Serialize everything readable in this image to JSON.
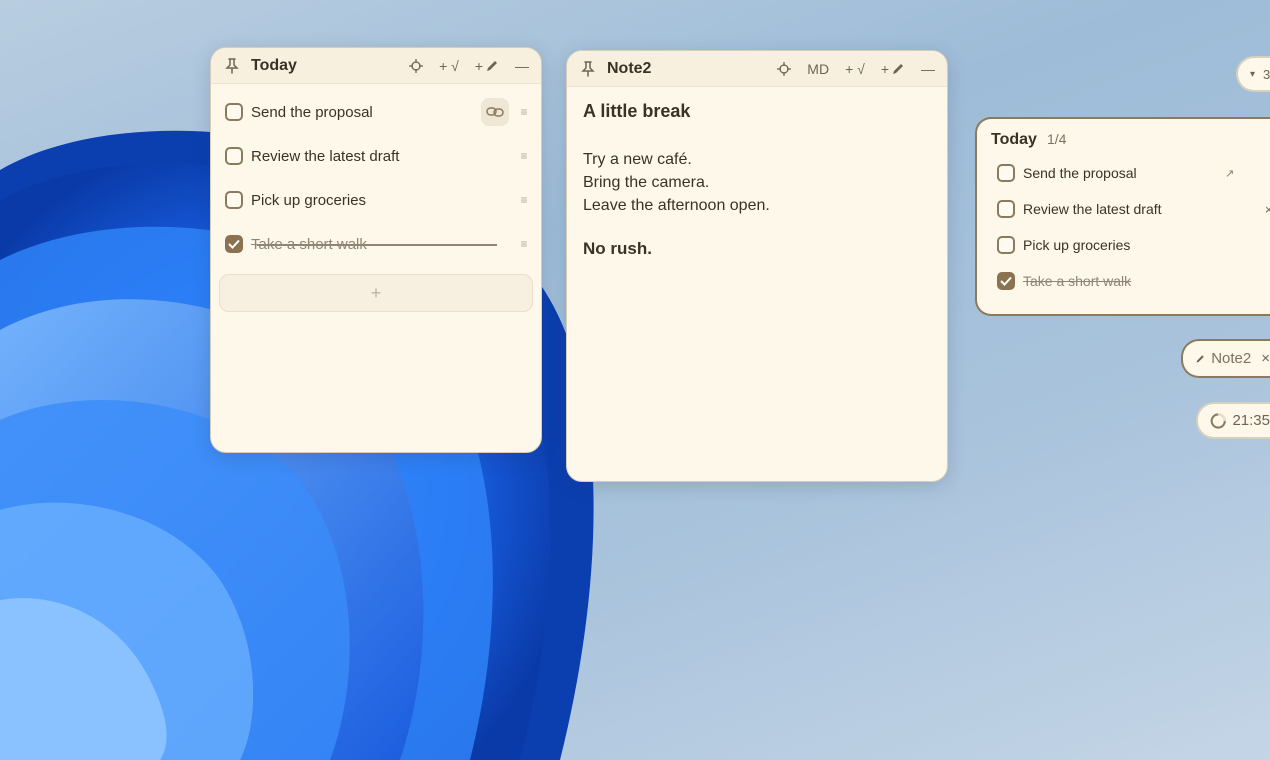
{
  "window_today": {
    "title": "Today",
    "buttons": {
      "locate": "⌖",
      "add_todo": "+ √",
      "add_note": "+",
      "minimize": "—"
    },
    "items": [
      {
        "text": "Send the proposal",
        "done": false
      },
      {
        "text": "Review the latest draft",
        "done": false
      },
      {
        "text": "Pick up groceries",
        "done": false
      },
      {
        "text": "Take a short walk",
        "done": true
      }
    ],
    "add_label": "+"
  },
  "window_note": {
    "title": "Note2",
    "buttons": {
      "locate": "⌖",
      "markdown": "MD",
      "add_todo": "+ √",
      "add_note": "+",
      "minimize": "—"
    },
    "heading": "A little break",
    "lines": [
      "Try a new café.",
      "Bring the camera.",
      "Leave the afternoon open."
    ],
    "footer": "No rush."
  },
  "mini_today": {
    "title": "Today",
    "count": "1/4",
    "items": [
      {
        "text": "Send the proposal",
        "done": false
      },
      {
        "text": "Review the latest draft",
        "done": false
      },
      {
        "text": "Pick up groceries",
        "done": false
      },
      {
        "text": "Take a short walk",
        "done": true
      }
    ],
    "expand_icon": "↗",
    "close_icon": "×"
  },
  "top_pill": {
    "arrow": "▾",
    "label": "3"
  },
  "note_pill": {
    "label": "Note2",
    "close": "×"
  },
  "time_pill": {
    "label": "21:35"
  },
  "icons": {
    "pin": "pin-icon",
    "locate": "crosshair-icon",
    "add_note": "pencil-icon",
    "minimize": "minus-icon",
    "link": "link-icon",
    "drag": "drag-handle-icon",
    "check": "check-icon",
    "timer": "timer-ring-icon"
  },
  "colors": {
    "window_bg": "#fdf8ea",
    "titlebar_bg": "#f8f0de",
    "accent_brown": "#8b7250",
    "text_dark": "#3a3226",
    "text_muted": "#8e8576",
    "wallpaper_blue": "#1f6ff2"
  }
}
